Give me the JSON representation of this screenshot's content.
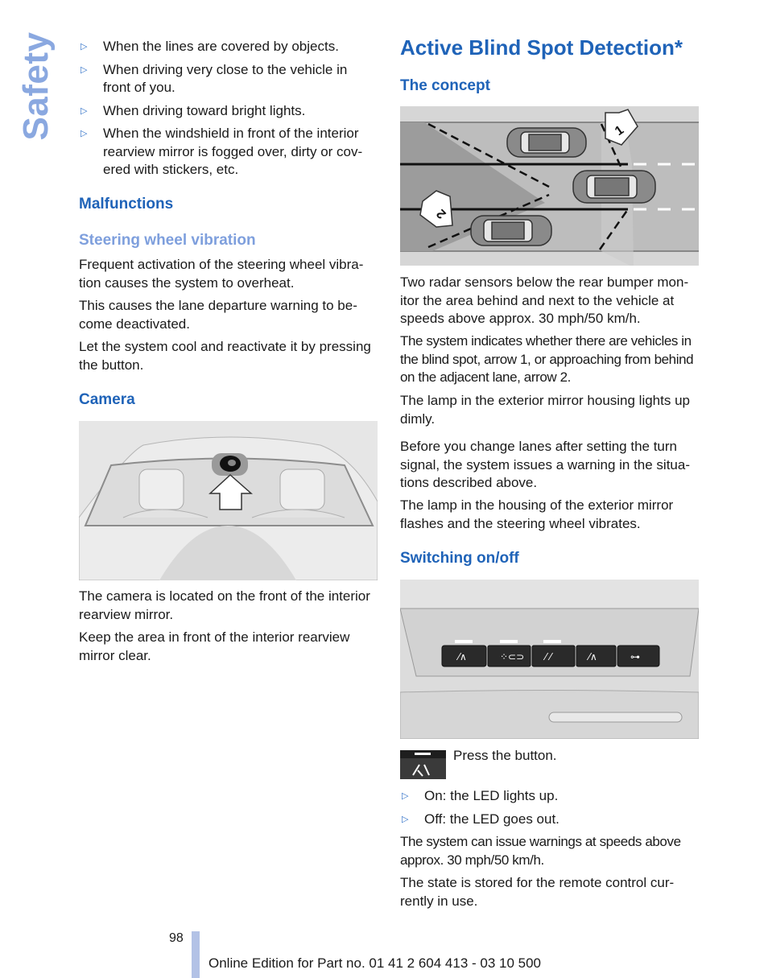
{
  "side_tab": "Safety",
  "left": {
    "bullets": [
      "When the lines are covered by objects.",
      "When driving very close to the vehicle in front of you.",
      "When driving toward bright lights.",
      "When the windshield in front of the interior rearview mirror is fogged over, dirty or cov-ered with stickers, etc."
    ],
    "malfunctions_heading": "Malfunctions",
    "steering_heading": "Steering wheel vibration",
    "steering_paras": [
      "Frequent activation of the steering wheel vibra-tion causes the system to overheat.",
      "This causes the lane departure warning to be-come deactivated.",
      "Let the system cool and reactivate it by pressing the button."
    ],
    "camera_heading": "Camera",
    "camera_figure": "rear-window-camera-illustration",
    "camera_paras": [
      "The camera is located on the front of the interior rearview mirror.",
      "Keep the area in front of the interior rearview mirror clear."
    ]
  },
  "right": {
    "title": "Active Blind Spot Detection*",
    "concept_heading": "The concept",
    "concept_figure": {
      "name": "blind-spot-diagram",
      "arrow_labels": [
        "1",
        "2"
      ]
    },
    "concept_paras": [
      "Two radar sensors below the rear bumper mon-itor the area behind and next to the vehicle at speeds above approx. 30 mph/50 km/h.",
      "The system indicates whether there are vehicles in the blind spot, arrow 1, or approaching from behind on the adjacent lane, arrow 2.",
      "The lamp in the exterior mirror housing lights up dimly.",
      "Before you change lanes after setting the turn signal, the system issues a warning in the situa-tions described above.",
      "The lamp in the housing of the exterior mirror flashes and the steering wheel vibrates."
    ],
    "switch_heading": "Switching on/off",
    "switch_figure": "button-panel-illustration",
    "press_text": "Press the button.",
    "switch_bullets": [
      "On: the LED lights up.",
      "Off: the LED goes out."
    ],
    "switch_paras": [
      "The system can issue warnings at speeds above approx. 30 mph/50 km/h.",
      "The state is stored for the remote control cur-rently in use."
    ]
  },
  "footer": {
    "page_number": "98",
    "edition": "Online Edition for Part no. 01 41 2 604 413 - 03 10 500"
  },
  "colors": {
    "heading_blue": "#1f63b8",
    "subheading_light_blue": "#7e9fdd",
    "side_tab": "#8aa8e0",
    "footer_bar": "#b3c2e6"
  }
}
